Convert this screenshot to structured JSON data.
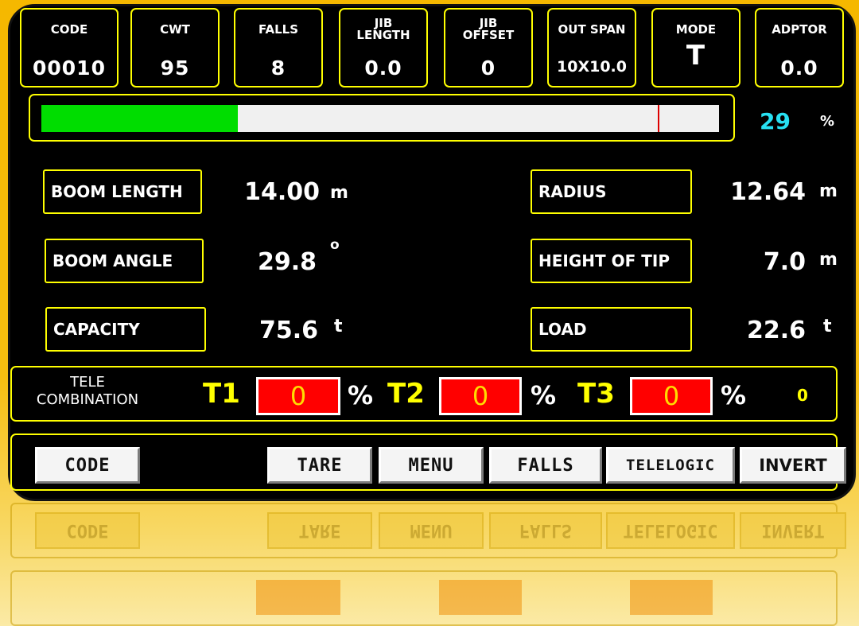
{
  "header": [
    {
      "label": "CODE",
      "value": "00010"
    },
    {
      "label": "CWT",
      "value": "95"
    },
    {
      "label": "FALLS",
      "value": "8"
    },
    {
      "label": "JIB\nLENGTH",
      "value": "0.0"
    },
    {
      "label": "JIB\nOFFSET",
      "value": "0"
    },
    {
      "label": "OUT SPAN",
      "value": "10X10.0"
    },
    {
      "label": "MODE",
      "value": "T"
    },
    {
      "label": "ADPTOR",
      "value": "0.0"
    }
  ],
  "load_moment": {
    "percent": "29",
    "unit": "%",
    "fill_fraction": 0.29,
    "limit_fraction": 0.91
  },
  "params_left": [
    {
      "label": "BOOM LENGTH",
      "value": "14.00",
      "unit": "m"
    },
    {
      "label": "BOOM ANGLE",
      "value": "29.8",
      "unit": "o"
    },
    {
      "label": "CAPACITY",
      "value": "75.6",
      "unit": "t"
    }
  ],
  "params_right": [
    {
      "label": "RADIUS",
      "value": "12.64",
      "unit": "m"
    },
    {
      "label": "HEIGHT OF TIP",
      "value": "7.0",
      "unit": "m"
    },
    {
      "label": "LOAD",
      "value": "22.6",
      "unit": "t"
    }
  ],
  "tele": {
    "label": "TELE\nCOMBINATION",
    "t1": {
      "name": "T1",
      "value": "0",
      "unit": "%"
    },
    "t2": {
      "name": "T2",
      "value": "0",
      "unit": "%"
    },
    "t3": {
      "name": "T3",
      "value": "0",
      "unit": "%"
    },
    "count": "0"
  },
  "buttons": [
    "CODE",
    "TARE",
    "MENU",
    "FALLS",
    "TELELOGIC",
    "INVERT"
  ],
  "colors": {
    "frame": "#f5b800",
    "box_border": "#ffff00",
    "bar_fill": "#00dd00",
    "percent_text": "#27e0f2",
    "tele_box": "#ff0000"
  }
}
